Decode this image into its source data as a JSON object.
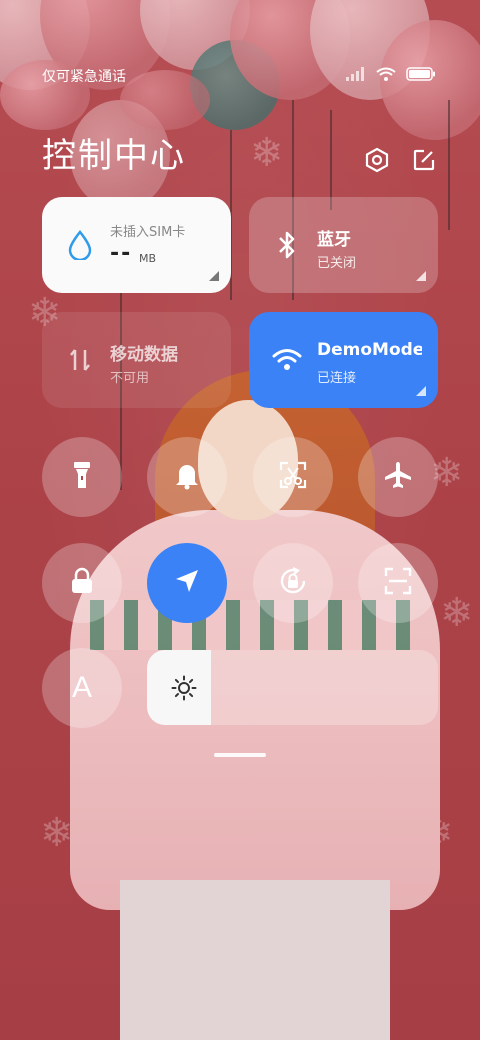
{
  "status_bar": {
    "carrier_text": "仅可紧急通话",
    "icons": [
      "signal-icon",
      "wifi-icon",
      "battery-icon"
    ]
  },
  "header": {
    "title": "控制中心",
    "icons": [
      "settings-icon",
      "edit-icon"
    ]
  },
  "tiles": {
    "sim": {
      "line1": "未插入SIM卡",
      "value": "--",
      "unit": "MB",
      "icon": "water-drop-icon"
    },
    "bluetooth": {
      "title": "蓝牙",
      "status": "已关闭",
      "icon": "bluetooth-icon"
    },
    "mobile_data": {
      "title": "移动数据",
      "status": "不可用",
      "icon": "data-arrows-icon"
    },
    "wifi": {
      "title": "DemoMode",
      "status": "已连接",
      "icon": "wifi-icon"
    }
  },
  "toggles": [
    {
      "name": "flashlight",
      "icon": "flashlight-icon",
      "active": false
    },
    {
      "name": "mute",
      "icon": "bell-icon",
      "active": false
    },
    {
      "name": "screenshot",
      "icon": "scissors-icon",
      "active": false
    },
    {
      "name": "airplane-mode",
      "icon": "airplane-icon",
      "active": false
    },
    {
      "name": "lock-screen",
      "icon": "lock-icon",
      "active": false
    },
    {
      "name": "location",
      "icon": "location-arrow-icon",
      "active": true
    },
    {
      "name": "rotation-lock",
      "icon": "rotation-lock-icon",
      "active": false
    },
    {
      "name": "scanner",
      "icon": "scan-icon",
      "active": false
    },
    {
      "name": "font-size",
      "icon": "font-icon",
      "label": "A",
      "active": false
    }
  ],
  "brightness": {
    "level": 0.22,
    "icon": "sun-icon"
  },
  "colors": {
    "accent": "#3b82f6",
    "tile_white": "#fafafa",
    "wallpaper": "#b0474d"
  }
}
